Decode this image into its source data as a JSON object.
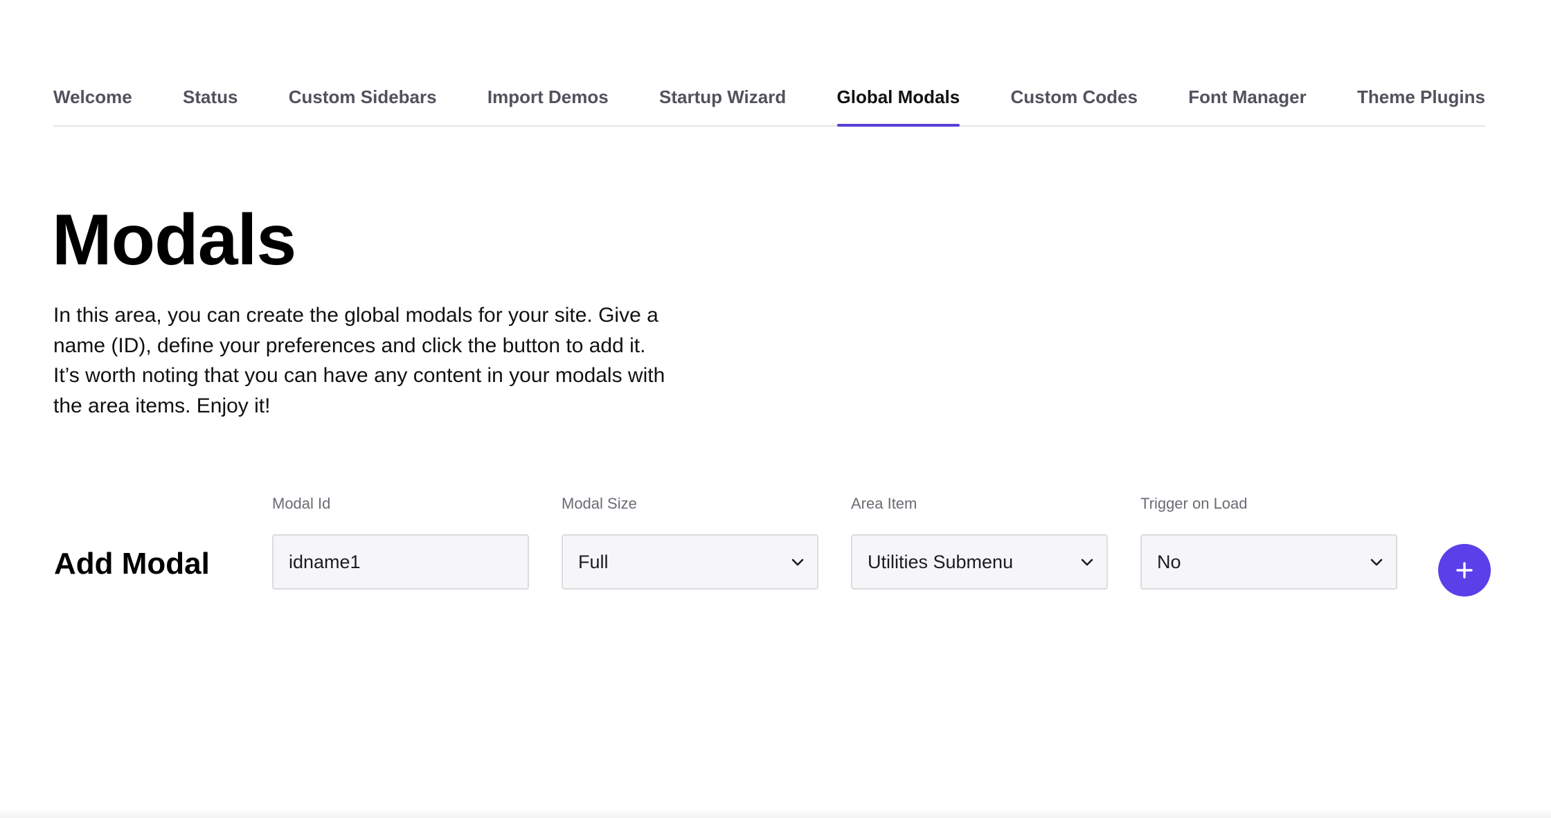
{
  "nav": {
    "tabs": [
      {
        "label": "Welcome",
        "active": false
      },
      {
        "label": "Status",
        "active": false
      },
      {
        "label": "Custom Sidebars",
        "active": false
      },
      {
        "label": "Import Demos",
        "active": false
      },
      {
        "label": "Startup Wizard",
        "active": false
      },
      {
        "label": "Global Modals",
        "active": true
      },
      {
        "label": "Custom Codes",
        "active": false
      },
      {
        "label": "Font Manager",
        "active": false
      },
      {
        "label": "Theme Plugins",
        "active": false
      }
    ]
  },
  "main": {
    "title": "Modals",
    "description_lines": [
      "In this area, you can create the global modals for your site. Give a",
      "name (ID), define your preferences and click the button to add it.",
      "It’s worth noting that you can have any content in your modals with",
      "the area items. Enjoy it!"
    ]
  },
  "add_modal": {
    "heading": "Add Modal",
    "fields": {
      "modal_id": {
        "label": "Modal Id",
        "value": "idname1"
      },
      "modal_size": {
        "label": "Modal Size",
        "value": "Full"
      },
      "area_item": {
        "label": "Area Item",
        "value": "Utilities Submenu"
      },
      "trigger_on_load": {
        "label": "Trigger on Load",
        "value": "No"
      }
    },
    "add_button_icon": "plus-icon"
  },
  "colors": {
    "accent": "#5b3fe8",
    "tab_underline": "#5b3fd6",
    "tab_inactive": "#51525c"
  }
}
